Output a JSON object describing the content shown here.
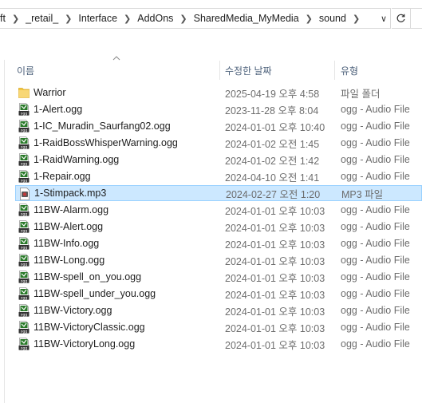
{
  "address": {
    "crumbs": [
      "ft",
      "_retail_",
      "Interface",
      "AddOns",
      "SharedMedia_MyMedia",
      "sound"
    ]
  },
  "columns": {
    "name": "이름",
    "date": "수정한 날짜",
    "type": "유형"
  },
  "files": [
    {
      "name": "Warrior",
      "date": "2025-04-19 오후 4:58",
      "type": "파일 폴더",
      "icon": "folder-icon"
    },
    {
      "name": "1-Alert.ogg",
      "date": "2023-11-28 오후 8:04",
      "type": "ogg - Audio File",
      "icon": "ogg-file-icon"
    },
    {
      "name": "1-IC_Muradin_Saurfang02.ogg",
      "date": "2024-01-01 오후 10:40",
      "type": "ogg - Audio File",
      "icon": "ogg-file-icon"
    },
    {
      "name": "1-RaidBossWhisperWarning.ogg",
      "date": "2024-01-02 오전 1:45",
      "type": "ogg - Audio File",
      "icon": "ogg-file-icon"
    },
    {
      "name": "1-RaidWarning.ogg",
      "date": "2024-01-02 오전 1:42",
      "type": "ogg - Audio File",
      "icon": "ogg-file-icon"
    },
    {
      "name": "1-Repair.ogg",
      "date": "2024-04-10 오전 1:41",
      "type": "ogg - Audio File",
      "icon": "ogg-file-icon"
    },
    {
      "name": "1-Stimpack.mp3",
      "date": "2024-02-27 오전 1:20",
      "type": "MP3 파일",
      "icon": "mp3-file-icon",
      "selected": true
    },
    {
      "name": "11BW-Alarm.ogg",
      "date": "2024-01-01 오후 10:03",
      "type": "ogg - Audio File",
      "icon": "ogg-file-icon"
    },
    {
      "name": "11BW-Alert.ogg",
      "date": "2024-01-01 오후 10:03",
      "type": "ogg - Audio File",
      "icon": "ogg-file-icon"
    },
    {
      "name": "11BW-Info.ogg",
      "date": "2024-01-01 오후 10:03",
      "type": "ogg - Audio File",
      "icon": "ogg-file-icon"
    },
    {
      "name": "11BW-Long.ogg",
      "date": "2024-01-01 오후 10:03",
      "type": "ogg - Audio File",
      "icon": "ogg-file-icon"
    },
    {
      "name": "11BW-spell_on_you.ogg",
      "date": "2024-01-01 오후 10:03",
      "type": "ogg - Audio File",
      "icon": "ogg-file-icon"
    },
    {
      "name": "11BW-spell_under_you.ogg",
      "date": "2024-01-01 오후 10:03",
      "type": "ogg - Audio File",
      "icon": "ogg-file-icon"
    },
    {
      "name": "11BW-Victory.ogg",
      "date": "2024-01-01 오후 10:03",
      "type": "ogg - Audio File",
      "icon": "ogg-file-icon"
    },
    {
      "name": "11BW-VictoryClassic.ogg",
      "date": "2024-01-01 오후 10:03",
      "type": "ogg - Audio File",
      "icon": "ogg-file-icon"
    },
    {
      "name": "11BW-VictoryLong.ogg",
      "date": "2024-01-01 오후 10:03",
      "type": "ogg - Audio File",
      "icon": "ogg-file-icon"
    }
  ],
  "colors": {
    "selection_bg": "#cce8ff",
    "selection_border": "#99d1ff",
    "header_text": "#4c607a",
    "folder": "#f3c63f",
    "ogg_badge": "#2a7a2a"
  }
}
